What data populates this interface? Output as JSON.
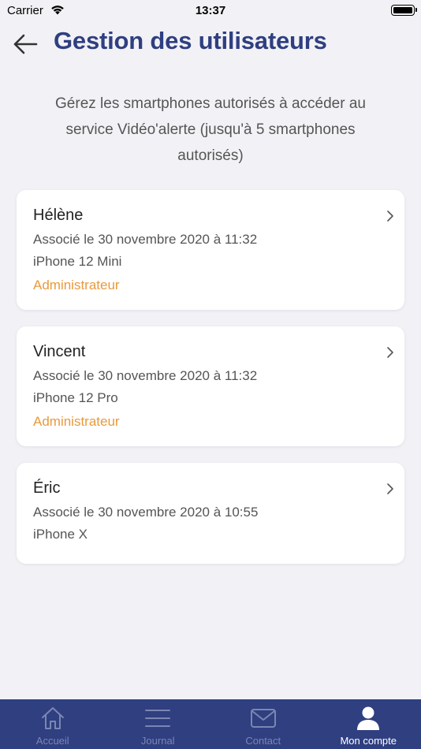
{
  "status_bar": {
    "carrier": "Carrier",
    "time": "13:37"
  },
  "header": {
    "title": "Gestion des utilisateurs",
    "back_icon": "arrow-left-icon"
  },
  "description": "Gérez les smartphones autorisés à accéder au service Vidéo'alerte (jusqu'à 5 smartphones autorisés)",
  "users": [
    {
      "name": "Hélène",
      "associated": "Associé le 30 novembre 2020 à 11:32",
      "device": "iPhone 12 Mini",
      "role": "Administrateur"
    },
    {
      "name": "Vincent",
      "associated": "Associé le 30 novembre 2020 à 11:32",
      "device": "iPhone 12 Pro",
      "role": "Administrateur"
    },
    {
      "name": "Éric",
      "associated": "Associé le 30 novembre 2020 à 10:55",
      "device": "iPhone X",
      "role": ""
    }
  ],
  "tab_bar": {
    "tabs": [
      {
        "label": "Accueil",
        "icon": "home-icon",
        "active": false
      },
      {
        "label": "Journal",
        "icon": "list-icon",
        "active": false
      },
      {
        "label": "Contact",
        "icon": "envelope-icon",
        "active": false
      },
      {
        "label": "Mon compte",
        "icon": "user-icon",
        "active": true
      }
    ]
  },
  "colors": {
    "brand": "#2f3f80",
    "accent": "#e89a3c",
    "background": "#f2f2f6"
  }
}
